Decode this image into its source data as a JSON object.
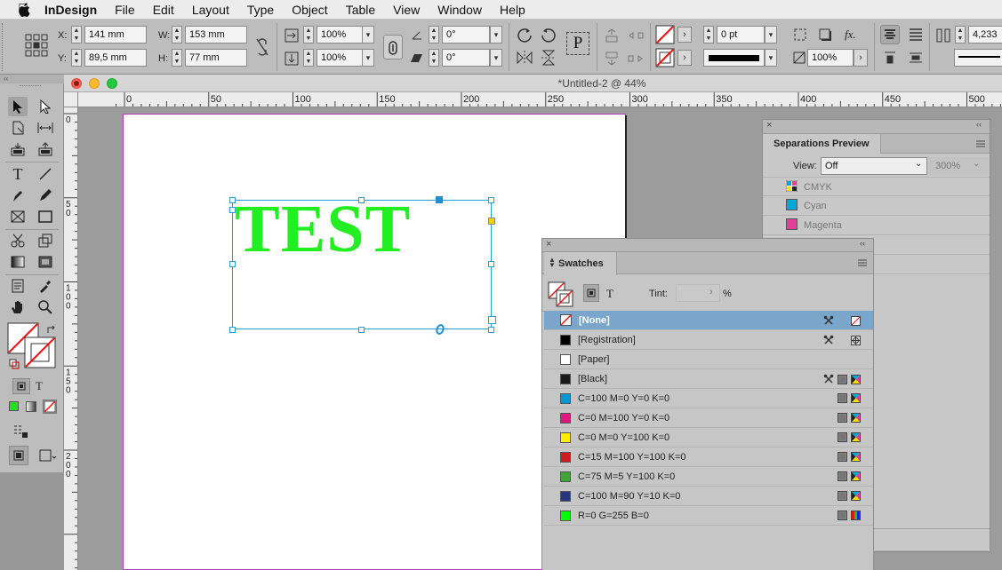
{
  "menubar": {
    "app": "InDesign",
    "items": [
      "File",
      "Edit",
      "Layout",
      "Type",
      "Object",
      "Table",
      "View",
      "Window",
      "Help"
    ]
  },
  "control": {
    "x_label": "X:",
    "x_value": "141 mm",
    "y_label": "Y:",
    "y_value": "89,5 mm",
    "w_label": "W:",
    "w_value": "153 mm",
    "h_label": "H:",
    "h_value": "77 mm",
    "scale_x": "100%",
    "scale_y": "100%",
    "rotate": "0°",
    "shear": "0°",
    "stroke_weight": "0 pt",
    "opacity": "100%",
    "extra_value": "4,233",
    "glyph_p": "P",
    "fx": "fx."
  },
  "document": {
    "title": "*Untitled-2 @ 44%",
    "ruler_h": [
      "0",
      "50",
      "100",
      "150",
      "200",
      "250",
      "300",
      "350",
      "400",
      "450",
      "500"
    ],
    "ruler_v": [
      [
        "0"
      ],
      [
        "5",
        "0"
      ],
      [
        "1",
        "0",
        "0"
      ],
      [
        "1",
        "5",
        "0"
      ],
      [
        "2",
        "0",
        "0"
      ]
    ],
    "frame_text": "TEST",
    "text_color": "#22ee22"
  },
  "tools": {
    "type_label": "T"
  },
  "separations": {
    "title": "Separations Preview",
    "view_label": "View:",
    "view_value": "Off",
    "zoom": "300%",
    "rows": [
      {
        "name": "CMYK",
        "color": "cmyk"
      },
      {
        "name": "Cyan",
        "color": "#00a8d6"
      },
      {
        "name": "Magenta",
        "color": "#e0409a"
      }
    ]
  },
  "swatches": {
    "title": "Swatches",
    "tint_label": "Tint:",
    "tint_value": "",
    "percent": "%",
    "type_label": "T",
    "items": [
      {
        "name": "[None]",
        "color": "none",
        "lock": true,
        "type": "none",
        "selected": true
      },
      {
        "name": "[Registration]",
        "color": "#000000",
        "lock": true,
        "type": "reg"
      },
      {
        "name": "[Paper]",
        "color": "#ffffff",
        "lock": false,
        "type": ""
      },
      {
        "name": "[Black]",
        "color": "#1a1a1a",
        "lock": true,
        "type": "cmyk"
      },
      {
        "name": "C=100 M=0 Y=0 K=0",
        "color": "#0099d8",
        "type": "cmyk"
      },
      {
        "name": "C=0 M=100 Y=0 K=0",
        "color": "#e0157d",
        "type": "cmyk"
      },
      {
        "name": "C=0 M=0 Y=100 K=0",
        "color": "#ffec00",
        "type": "cmyk"
      },
      {
        "name": "C=15 M=100 Y=100 K=0",
        "color": "#cf1b22",
        "type": "cmyk"
      },
      {
        "name": "C=75 M=5 Y=100 K=0",
        "color": "#3fa535",
        "type": "cmyk"
      },
      {
        "name": "C=100 M=90 Y=10 K=0",
        "color": "#283583",
        "type": "cmyk"
      },
      {
        "name": "R=0 G=255 B=0",
        "color": "#00ff00",
        "type": "rgb"
      }
    ]
  }
}
